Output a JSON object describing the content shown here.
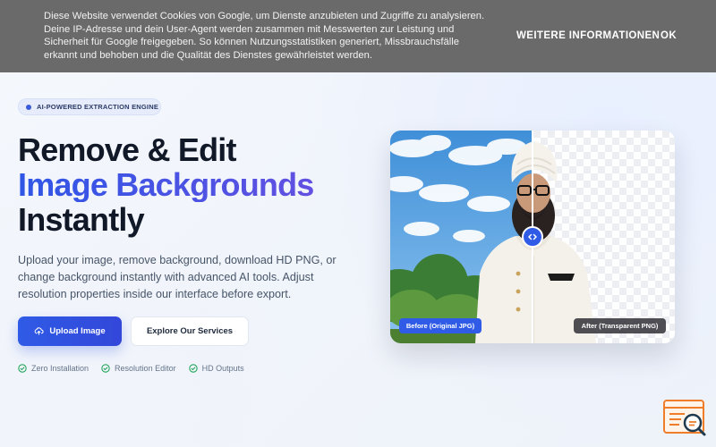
{
  "cookie_bar": {
    "text": "Diese Website verwendet Cookies von Google, um Dienste anzubieten und Zugriffe zu analysieren. Deine IP-Adresse und dein User-Agent werden zusammen mit Messwerten zur Leistung und Sicherheit für Google freigegeben. So können Nutzungsstatistiken generiert, Missbrauchsfälle erkannt und behoben und die Qualität des Dienstes gewährleistet werden.",
    "more_label": "WEITERE INFORMATIONEN",
    "ok_label": "OK"
  },
  "hero": {
    "badge": "AI-POWERED EXTRACTION ENGINE",
    "headline_line1": "Remove & Edit",
    "headline_line2": "Image Backgrounds",
    "headline_line3": "Instantly",
    "subtitle": "Upload your image, remove background, download HD PNG, or change background instantly with advanced AI tools. Adjust resolution properties inside our interface before export.",
    "primary_button": "Upload Image",
    "secondary_button": "Explore Our Services",
    "features": [
      "Zero Installation",
      "Resolution Editor",
      "HD Outputs"
    ]
  },
  "comparison": {
    "before_label": "Before (Original JPG)",
    "after_label": "After (Transparent PNG)"
  },
  "icons": {
    "upload": "cloud-upload-icon",
    "check": "check-circle-icon",
    "handle": "code-arrows-icon",
    "help": "search-document-icon"
  },
  "colors": {
    "accent": "#2f5be7",
    "accent_purple": "#6c4fe0",
    "cookie_bg": "#6a6a6a",
    "feature_check": "#22a55b",
    "help_widget": "#ef7d2a"
  }
}
